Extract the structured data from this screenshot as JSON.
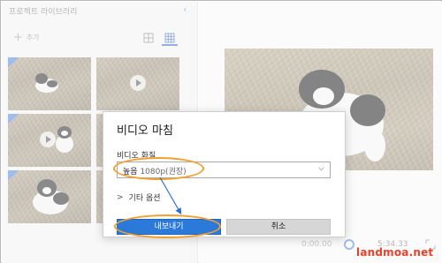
{
  "library": {
    "title": "프로젝트 라이브러리",
    "add_label": "추가",
    "collapse_icon": "chevron-left-icon",
    "view_toggle_icons": [
      "grid-large-icon",
      "grid-small-icon"
    ],
    "thumbnails": [
      {
        "name": "cat-photo-1",
        "has_play": false
      },
      {
        "name": "cat-video-1",
        "has_play": true
      },
      {
        "name": "cat-video-2",
        "has_play": true
      },
      {
        "name": "cat-photo-2",
        "has_play": false
      },
      {
        "name": "cat-photo-3",
        "has_play": false
      },
      {
        "name": "cat-photo-4",
        "has_play": false
      }
    ]
  },
  "preview": {
    "time": "5:34.33",
    "left_time": "0:00.00"
  },
  "dialog": {
    "title": "비디오 마침",
    "quality_label": "비디오 화질",
    "quality_value_main": "높음",
    "quality_value_sub": "1080p(권장)",
    "more_options": "기타 옵션",
    "export_label": "내보내기",
    "cancel_label": "취소"
  },
  "colors": {
    "accent": "#2b79d9",
    "highlight": "#f2a030",
    "watermark": "#e8412a"
  },
  "watermark": "landmoa.net"
}
